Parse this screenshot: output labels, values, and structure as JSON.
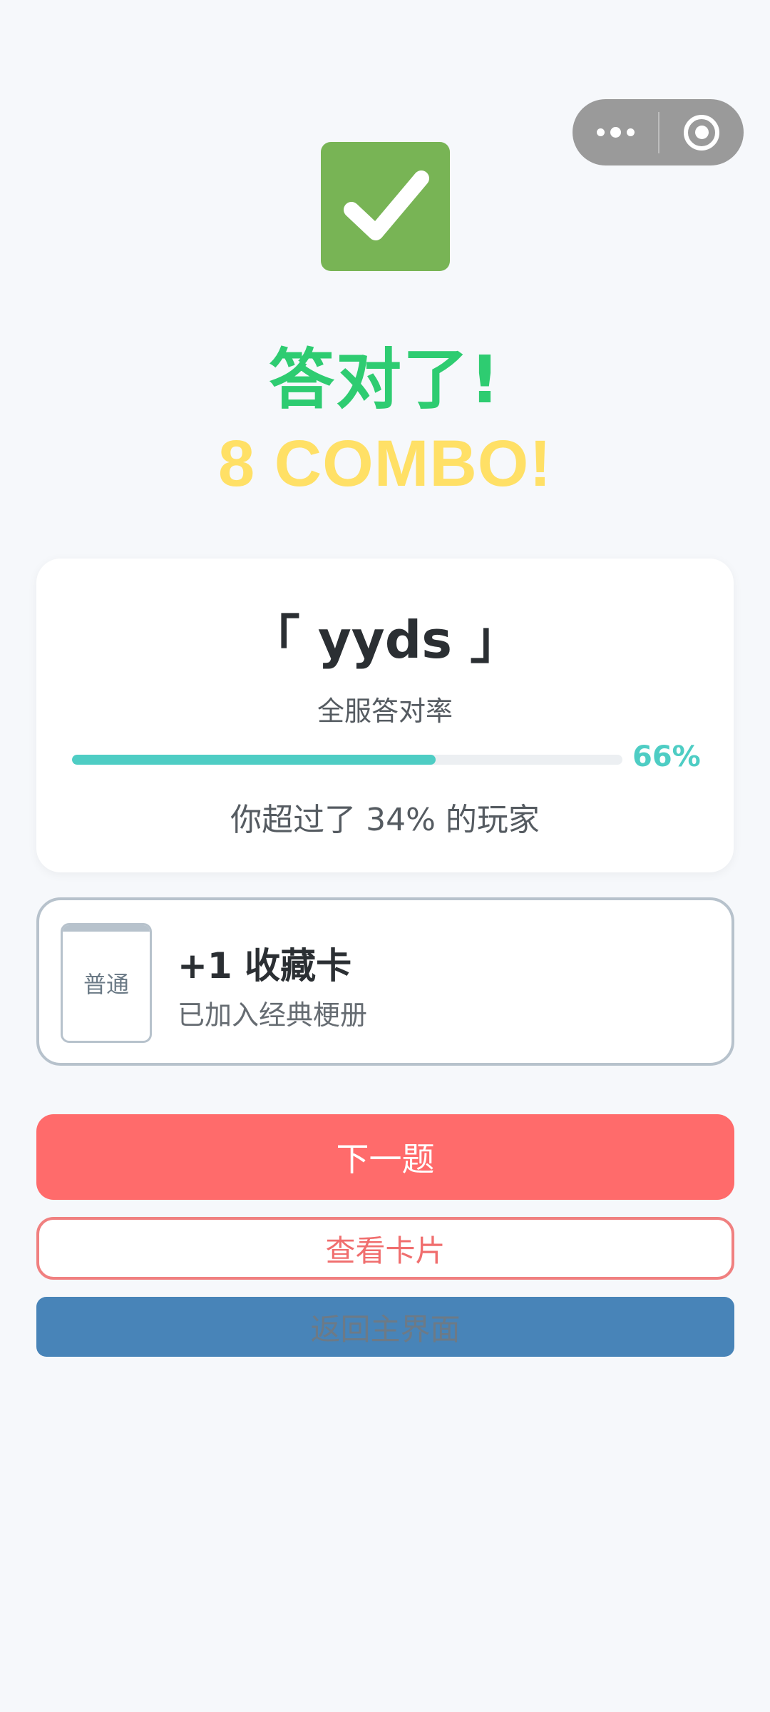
{
  "capsule": {
    "more_icon": "more-dots-icon",
    "close_icon": "target-close-icon"
  },
  "result": {
    "icon": "check-mark-icon",
    "icon_color": "#78b455",
    "title": "答对了!",
    "title_color": "#2ecc71",
    "combo": "8 COMBO!",
    "combo_color": "#ffe066"
  },
  "stat": {
    "meme": "「 yyds 」",
    "label": "全服答对率",
    "correct_rate": 66,
    "correct_rate_text": "66%",
    "beat_text": "你超过了 34% 的玩家",
    "accent_color": "#4ecdc4"
  },
  "collect": {
    "card_rarity": "普通",
    "title": "+1 收藏卡",
    "subtitle": "已加入经典梗册"
  },
  "buttons": {
    "next": "下一题",
    "view_cards": "查看卡片",
    "home": "返回主界面",
    "next_color": "#ff6b6b",
    "home_color": "#4884b8"
  }
}
